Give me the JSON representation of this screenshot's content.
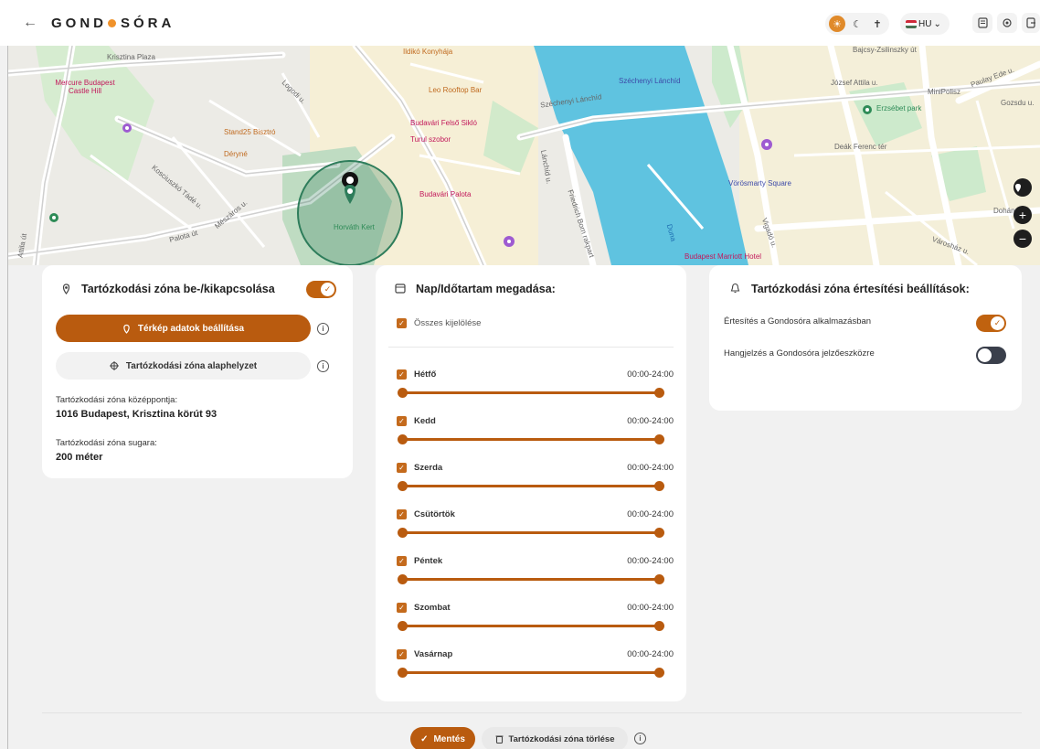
{
  "header": {
    "logo_left": "GOND",
    "logo_right": "SÓRA",
    "back_icon": "←",
    "theme_icons": [
      "☀",
      "☾",
      "✝"
    ],
    "language": "HU",
    "language_caret": "⌄",
    "icons": [
      "document-icon",
      "settings-icon",
      "logout-icon"
    ]
  },
  "map": {
    "labels": {
      "krisztina_plaza": "Krisztina Plaza",
      "mercure": "Mercure Budapest Castle Hill",
      "ildiko": "Ildikó Konyhája",
      "leo": "Leo Rooftop Bar",
      "szechenyi": "Széchenyi Lánchíd",
      "szechenyi_road": "Széchenyi Lánchíd",
      "budavari_siklo": "Budavári Felső Sikló",
      "turul": "Turul szobor",
      "stand25": "Stand25 Bisztró",
      "deryne": "Déryné",
      "budavari_palota": "Budavári Palota",
      "horvath_kert": "Horváth Kert",
      "friedrich_born": "Friedrich Born rakpart",
      "duna": "Duna",
      "budapest_marriott": "Budapest Marriott Hotel",
      "vorosmarty": "Vörösmarty Square",
      "deak": "Deák Ferenc tér",
      "erzsebet_park": "Erzsébet park",
      "minipolisz": "MiniPolisz",
      "bajcsy": "Bajcsy-Zsilinszky út",
      "jozsef_attila": "József Attila u.",
      "paulay": "Paulay Ede u.",
      "gozsdu": "Gozsdu u.",
      "dohany": "Dohány u.",
      "vigado": "Vigadó u.",
      "varoshaz": "Városház u.",
      "attila_ut": "Attila út",
      "lanchid_u": "Lánchíd u.",
      "mikszath": "Mészáros u.",
      "koszeg": "Kosciuszkó Tádé u.",
      "logodi": "Logodi u.",
      "palota": "Palota út"
    },
    "controls": {
      "location": "⬤",
      "zoom_in": "+",
      "zoom_out": "−"
    }
  },
  "zone_card": {
    "title": "Tartózkodási zóna be-/kikapcsolása",
    "toggle_on": true,
    "map_settings_button": "Térkép adatok beállítása",
    "reset_button": "Tartózkodási zóna alaphelyzet",
    "center_label": "Tartózkodási zóna középpontja:",
    "center_value": "1016 Budapest, Krisztina körút 93",
    "radius_label": "Tartózkodási zóna sugara:",
    "radius_value": "200 méter",
    "info_glyph": "i"
  },
  "schedule_card": {
    "title": "Nap/Időtartam megadása:",
    "select_all": "Összes kijelölése",
    "check_glyph": "✓",
    "days": [
      {
        "name": "Hétfő",
        "time": "00:00-24:00"
      },
      {
        "name": "Kedd",
        "time": "00:00-24:00"
      },
      {
        "name": "Szerda",
        "time": "00:00-24:00"
      },
      {
        "name": "Csütörtök",
        "time": "00:00-24:00"
      },
      {
        "name": "Péntek",
        "time": "00:00-24:00"
      },
      {
        "name": "Szombat",
        "time": "00:00-24:00"
      },
      {
        "name": "Vasárnap",
        "time": "00:00-24:00"
      }
    ]
  },
  "notification_card": {
    "title": "Tartózkodási zóna értesítési beállítások:",
    "items": [
      {
        "label": "Értesítés a Gondosóra alkalmazásban",
        "on": true
      },
      {
        "label": "Hangjelzés a Gondosóra jelzőeszközre",
        "on": false
      }
    ]
  },
  "footer": {
    "save": "Mentés",
    "delete": "Tartózkodási zóna törlése"
  },
  "colors": {
    "accent": "#b95b0f",
    "accent_light": "#e08a2a",
    "river": "#5fc3e0",
    "park": "#cdeacc",
    "zone": "#2e7d5b"
  }
}
